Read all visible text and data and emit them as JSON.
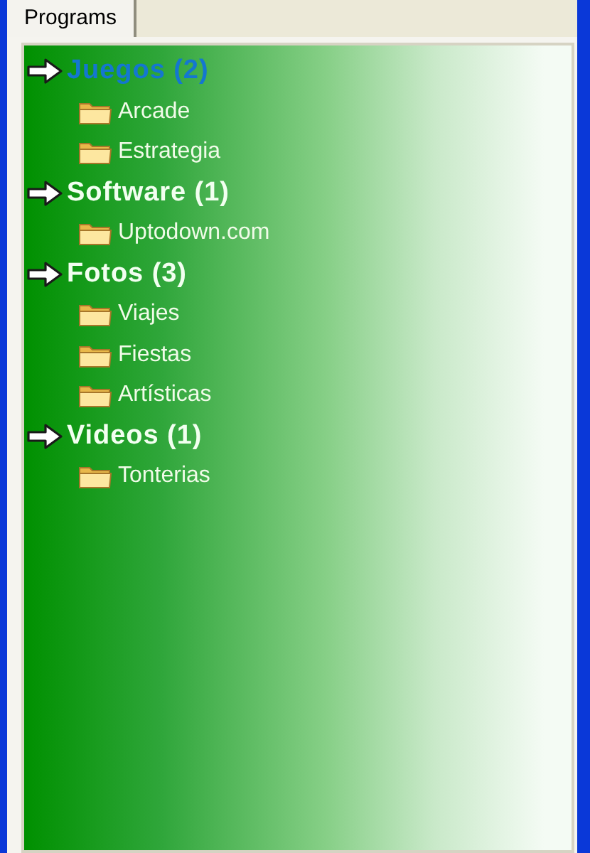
{
  "tab": {
    "label": "Programs",
    "selected": true
  },
  "groups": [
    {
      "label": "Juegos (2)",
      "selected": true,
      "children": [
        {
          "label": "Arcade"
        },
        {
          "label": "Estrategia"
        }
      ]
    },
    {
      "label": "Software (1)",
      "selected": false,
      "children": [
        {
          "label": "Uptodown.com"
        }
      ]
    },
    {
      "label": "Fotos (3)",
      "selected": false,
      "children": [
        {
          "label": "Viajes"
        },
        {
          "label": "Fiestas"
        },
        {
          "label": "Artísticas"
        }
      ]
    },
    {
      "label": "Videos (1)",
      "selected": false,
      "children": [
        {
          "label": "Tonterias"
        }
      ]
    }
  ]
}
